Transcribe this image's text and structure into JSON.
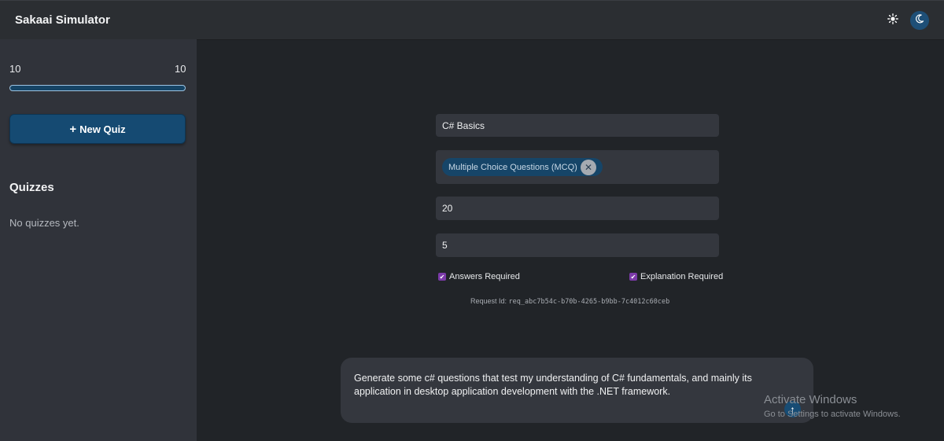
{
  "header": {
    "app_title": "Sakaai Simulator",
    "light_mode_icon": "☀",
    "dark_mode_icon": "☾"
  },
  "sidebar": {
    "range_min": "10",
    "range_max": "10",
    "new_quiz_icon": "+",
    "new_quiz_label": "New Quiz",
    "quizzes_heading": "Quizzes",
    "empty_text": "No quizzes yet."
  },
  "form": {
    "topic_value": "C# Basics",
    "question_type_chip": "Multiple Choice Questions (MCQ)",
    "chip_remove_icon": "✕",
    "question_count_value": "20",
    "options_count_value": "5",
    "answers_required_label": "Answers Required",
    "answers_required_checked": true,
    "explanation_required_label": "Explanation Required",
    "explanation_required_checked": true,
    "request_id_label": "Request Id:",
    "request_id_value": "req_abc7b54c-b70b-4265-b9bb-7c4012c60ceb"
  },
  "prompt": {
    "text": "Generate some c# questions that test my understanding of C# fundamentals, and mainly its application in desktop application development with the .NET framework.",
    "send_icon": "↑"
  },
  "os_watermark": {
    "title": "Activate Windows",
    "subtitle": "Go to Settings to activate Windows."
  },
  "colors": {
    "accent": "#154a72",
    "checkbox": "#7b3aa8",
    "background": "#212428",
    "sidebar": "#30333a"
  }
}
